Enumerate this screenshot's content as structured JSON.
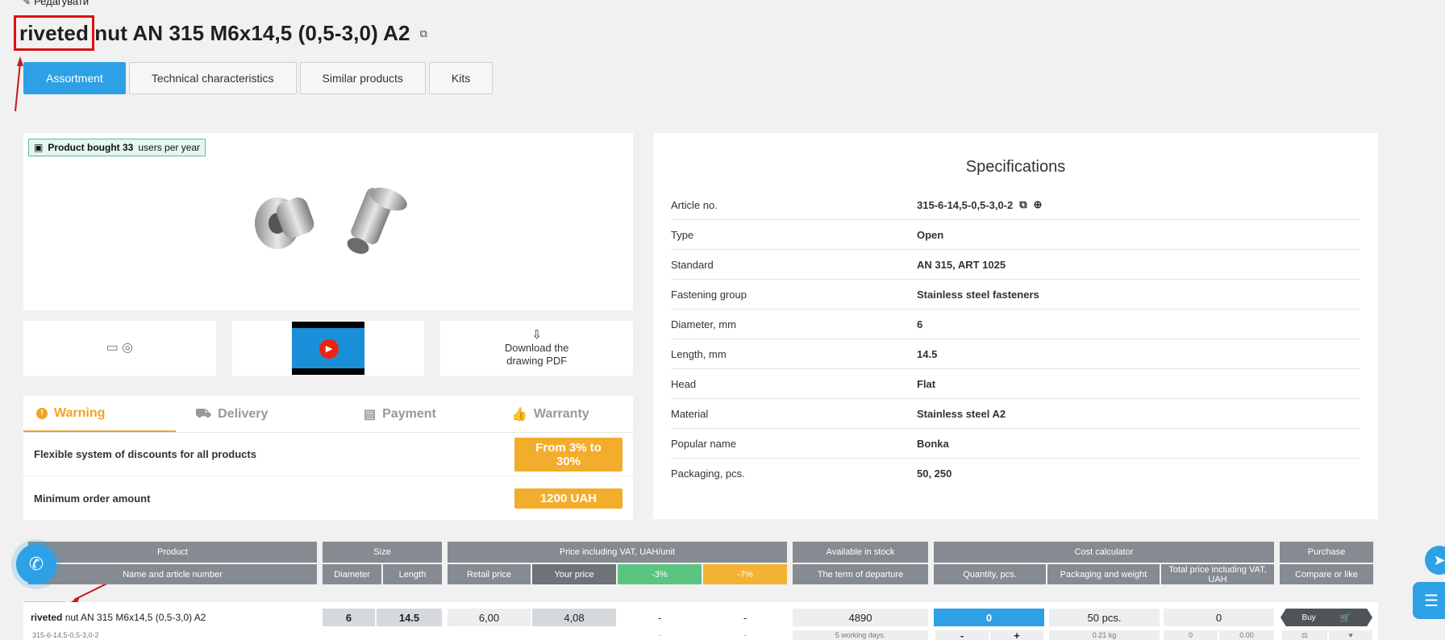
{
  "header": {
    "edit_label": "Редагувати",
    "title_highlight": "riveted",
    "title_rest": "nut AN 315 M6x14,5 (0,5-3,0) A2"
  },
  "tabs": [
    {
      "label": "Assortment",
      "active": true
    },
    {
      "label": "Technical characteristics"
    },
    {
      "label": "Similar products"
    },
    {
      "label": "Kits"
    }
  ],
  "badge": {
    "bold": "Product bought 33",
    "rest": "users per year"
  },
  "thumbs": {
    "download_label_1": "Download the",
    "download_label_2": "drawing PDF"
  },
  "info": {
    "tabs": [
      "Warning",
      "Delivery",
      "Payment",
      "Warranty"
    ],
    "rows": [
      {
        "label": "Flexible system of discounts for all products",
        "value": "From 3% to 30%"
      },
      {
        "label": "Minimum order amount",
        "value": "1200 UAH"
      }
    ]
  },
  "specs": {
    "title": "Specifications",
    "rows": [
      {
        "k": "Article no.",
        "v": "315-6-14,5-0,5-3,0-2"
      },
      {
        "k": "Type",
        "v": "Open"
      },
      {
        "k": "Standard",
        "v": "AN 315, ART 1025"
      },
      {
        "k": "Fastening group",
        "v": "Stainless steel fasteners"
      },
      {
        "k": "Diameter, mm",
        "v": "6"
      },
      {
        "k": "Length, mm",
        "v": "14.5"
      },
      {
        "k": "Head",
        "v": "Flat"
      },
      {
        "k": "Material",
        "v": "Stainless steel A2"
      },
      {
        "k": "Popular name",
        "v": "Bonka"
      },
      {
        "k": "Packaging, pcs.",
        "v": "50, 250"
      }
    ]
  },
  "table": {
    "groups": [
      "Product",
      "Size",
      "Price including VAT, UAH/unit",
      "Available in stock",
      "Cost calculator",
      "Purchase"
    ],
    "subs": [
      "Name and article number",
      "Diameter",
      "Length",
      "Retail price",
      "Your price",
      "-3%",
      "-7%",
      "The term of departure",
      "Quantity, pcs.",
      "Packaging and weight",
      "Total price including VAT, UAH",
      "Compare or like"
    ],
    "row": {
      "name_hl": "riveted",
      "name_rest": "nut AN 315 M6x14,5 (0,5-3,0) A2",
      "article": "315-6-14,5-0,5-3,0-2",
      "diameter": "6",
      "length": "14.5",
      "retail": "6,00",
      "your": "4,08",
      "d3": "-",
      "d7": "-",
      "stock": "4890",
      "qty": "0",
      "pack": "50 pcs.",
      "total": "0",
      "buy": "Buy",
      "d3b": "-",
      "d7b": "-",
      "term": "5 working days.",
      "minus": "-",
      "plus": "+",
      "weight": "0.21 kg",
      "total_b1": "0",
      "total_b2": "0.00"
    }
  },
  "colors": {
    "accent": "#2ea0e6",
    "warning": "#f0a422",
    "highlight_box": "#dd1111"
  }
}
